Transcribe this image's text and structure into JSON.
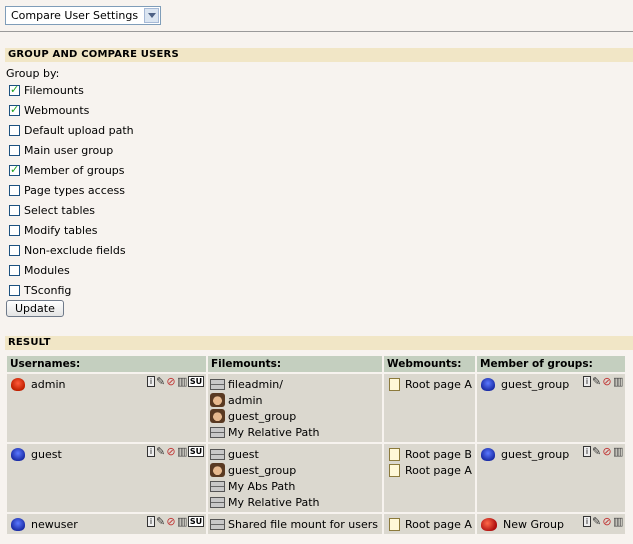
{
  "module_menu": {
    "selected": "Compare User Settings"
  },
  "group_section": {
    "title": "GROUP AND COMPARE USERS",
    "group_by_label": "Group by:",
    "options": [
      {
        "label": "Filemounts",
        "checked": true
      },
      {
        "label": "Webmounts",
        "checked": true
      },
      {
        "label": "Default upload path",
        "checked": false
      },
      {
        "label": "Main user group",
        "checked": false
      },
      {
        "label": "Member of groups",
        "checked": true
      },
      {
        "label": "Page types access",
        "checked": false
      },
      {
        "label": "Select tables",
        "checked": false
      },
      {
        "label": "Modify tables",
        "checked": false
      },
      {
        "label": "Non-exclude fields",
        "checked": false
      },
      {
        "label": "Modules",
        "checked": false
      },
      {
        "label": "TSconfig",
        "checked": false
      }
    ],
    "update_label": "Update"
  },
  "result_section": {
    "title": "RESULT",
    "headers": [
      "Usernames:",
      "Filemounts:",
      "Webmounts:",
      "Member of groups:"
    ],
    "rows": [
      {
        "user": "admin",
        "user_icon": "admin-user-icon",
        "filemounts": [
          {
            "label": "fileadmin/",
            "icon": "server-icon"
          },
          {
            "label": "admin",
            "icon": "user-face-icon"
          },
          {
            "label": "guest_group",
            "icon": "user-face-icon"
          },
          {
            "label": "My Relative Path",
            "icon": "server-icon"
          }
        ],
        "webmounts": [
          "Root page A"
        ],
        "groups": [
          {
            "label": "guest_group",
            "icon": "group-icon"
          }
        ]
      },
      {
        "user": "guest",
        "user_icon": "user-icon",
        "filemounts": [
          {
            "label": "guest",
            "icon": "server-icon"
          },
          {
            "label": "guest_group",
            "icon": "user-face-icon"
          },
          {
            "label": "My Abs Path",
            "icon": "server-icon"
          },
          {
            "label": "My Relative Path",
            "icon": "server-icon"
          }
        ],
        "webmounts": [
          "Root page B",
          "Root page A"
        ],
        "groups": [
          {
            "label": "guest_group",
            "icon": "group-icon"
          }
        ]
      },
      {
        "user": "newuser",
        "user_icon": "user-icon",
        "filemounts": [
          {
            "label": "Shared file mount for users",
            "icon": "server-icon"
          }
        ],
        "webmounts": [
          "Root page A"
        ],
        "groups": [
          {
            "label": "New Group",
            "icon": "group-red-icon"
          }
        ]
      }
    ],
    "action_su_label": "SU"
  }
}
